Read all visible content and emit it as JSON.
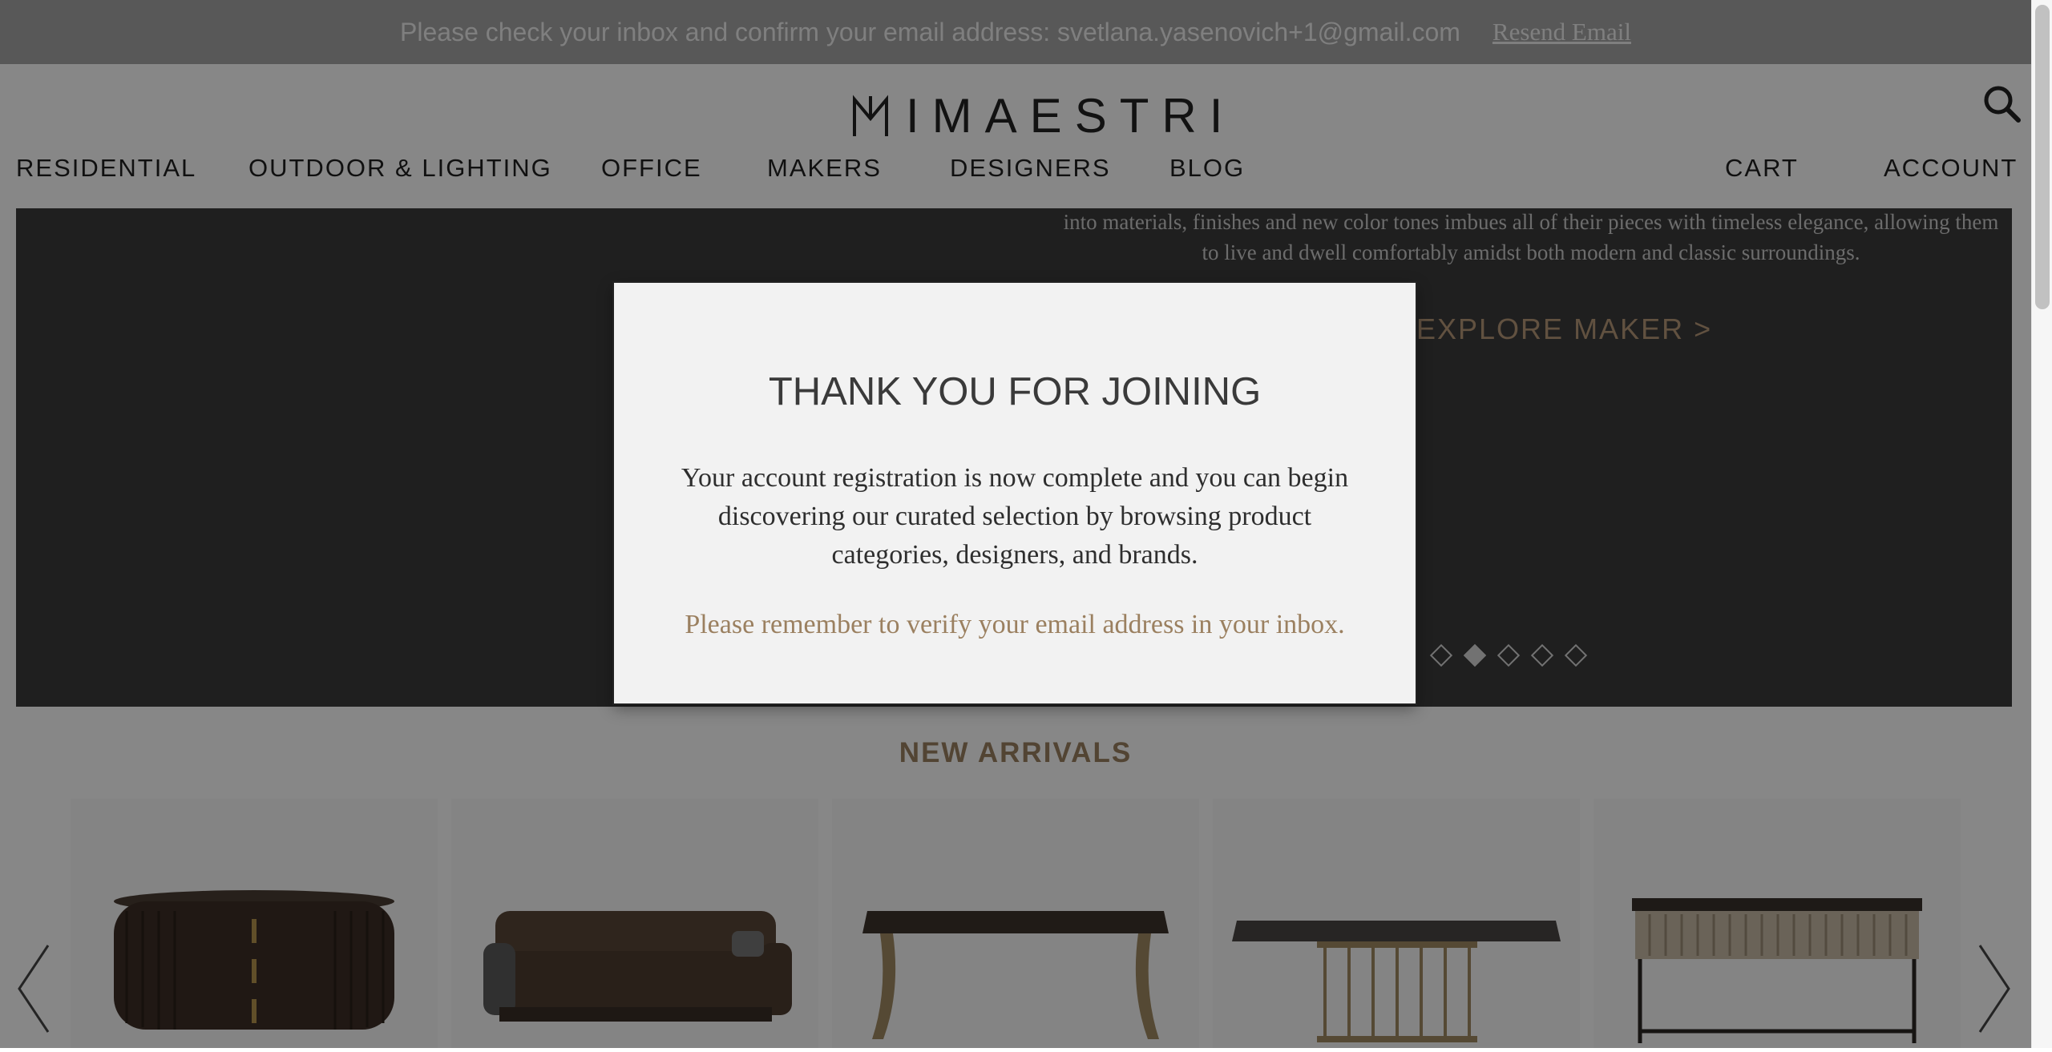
{
  "banner": {
    "message": "Please check your inbox and confirm your email address: svetlana.yasenovich+1@gmail.com",
    "resend_label": "Resend Email"
  },
  "header": {
    "logo_text": "IMAESTRI",
    "search_icon": "search-icon"
  },
  "nav": {
    "left": [
      "RESIDENTIAL",
      "OUTDOOR & LIGHTING",
      "OFFICE",
      "MAKERS",
      "DESIGNERS",
      "BLOG"
    ],
    "right": [
      "CART",
      "ACCOUNT"
    ]
  },
  "hero": {
    "copy": "into materials, finishes and new color tones imbues all of their pieces with timeless elegance, allowing them to live and dwell comfortably amidst both modern and classic surroundings.",
    "cta_label": "EXPLORE MAKER >",
    "slides_count": 5,
    "active_slide": 2
  },
  "arrivals": {
    "title": "NEW ARRIVALS",
    "products": [
      {
        "name": "oval-cabinet"
      },
      {
        "name": "sofa"
      },
      {
        "name": "dining-table"
      },
      {
        "name": "marble-table"
      },
      {
        "name": "console-table"
      }
    ]
  },
  "modal": {
    "title": "THANK YOU FOR JOINING",
    "body": "Your account registration is now complete and you can begin discovering our curated selection by browsing product categories, designers, and brands.",
    "note": "Please remember to verify your email address in your inbox."
  },
  "colors": {
    "accent": "#9b8060",
    "overlay": "rgba(0,0,0,0.47)",
    "hero_bg": "#3b3b3b"
  }
}
